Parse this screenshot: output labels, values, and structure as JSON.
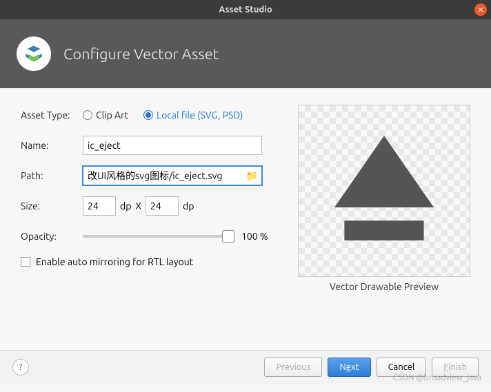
{
  "window": {
    "title": "Asset Studio"
  },
  "header": {
    "title": "Configure Vector Asset"
  },
  "form": {
    "assetType": {
      "label": "Asset Type:",
      "options": {
        "clipart": "Clip Art",
        "localfile": "Local file (SVG, PSD)"
      },
      "selected": "localfile"
    },
    "name": {
      "label": "Name:",
      "value": "ic_eject"
    },
    "path": {
      "label": "Path:",
      "value": "改UI风格的svg图标/ic_eject.svg"
    },
    "size": {
      "label": "Size:",
      "width": "24",
      "height": "24",
      "unit": "dp",
      "x": "X"
    },
    "opacity": {
      "label": "Opacity:",
      "value": "100 %"
    },
    "rtl": {
      "label": "Enable auto mirroring for RTL layout"
    }
  },
  "preview": {
    "caption": "Vector Drawable Preview"
  },
  "buttons": {
    "previous": "Previous",
    "next_prefix": "N",
    "next_ul": "e",
    "next_suffix": "xt",
    "cancel": "Cancel",
    "finish_prefix": "",
    "finish_ul": "F",
    "finish_suffix": "inish"
  },
  "watermark": "CSDN @broadview_java"
}
